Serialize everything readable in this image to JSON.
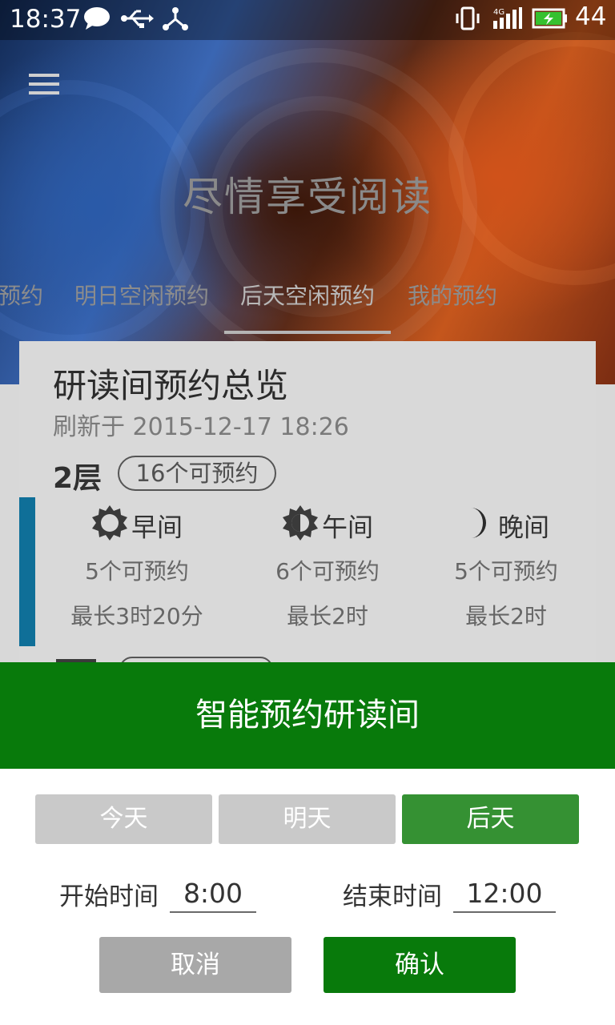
{
  "status_bar": {
    "time": "18:37",
    "battery_level": "44",
    "network": "4G",
    "icons": [
      "chat-bubble-icon",
      "usb-icon",
      "share-icon",
      "vibrate-icon",
      "signal-icon",
      "battery-charging-icon"
    ]
  },
  "hero": {
    "slogan": "尽情享受阅读",
    "tabs": [
      "预约",
      "明日空闲预约",
      "后天空闲预约",
      "我的预约"
    ],
    "active_tab_index": 2
  },
  "card": {
    "title": "研读间预约总览",
    "refresh": "刷新于 2015-12-17 18:26",
    "floor": "2层",
    "floor_available": "16个可预约",
    "slots": [
      {
        "name": "早间",
        "icon": "sun-icon",
        "count": "5个可预约",
        "max": "最长3时20分"
      },
      {
        "name": "午间",
        "icon": "half-sun-icon",
        "count": "6个可预约",
        "max": "最长2时"
      },
      {
        "name": "晚间",
        "icon": "moon-icon",
        "count": "5个可预约",
        "max": "最长2时"
      }
    ],
    "accent_color": "#0f6f98"
  },
  "dialog": {
    "title": "智能预约研读间",
    "days": [
      "今天",
      "明天",
      "后天"
    ],
    "selected_day_index": 2,
    "start_label": "开始时间",
    "start_value": "8:00",
    "end_label": "结束时间",
    "end_value": "12:00",
    "cancel": "取消",
    "confirm": "确认",
    "colors": {
      "header": "#087a0b",
      "selected_day": "#359133",
      "confirm": "#087a0b",
      "cancel": "#a8a8a8"
    }
  }
}
